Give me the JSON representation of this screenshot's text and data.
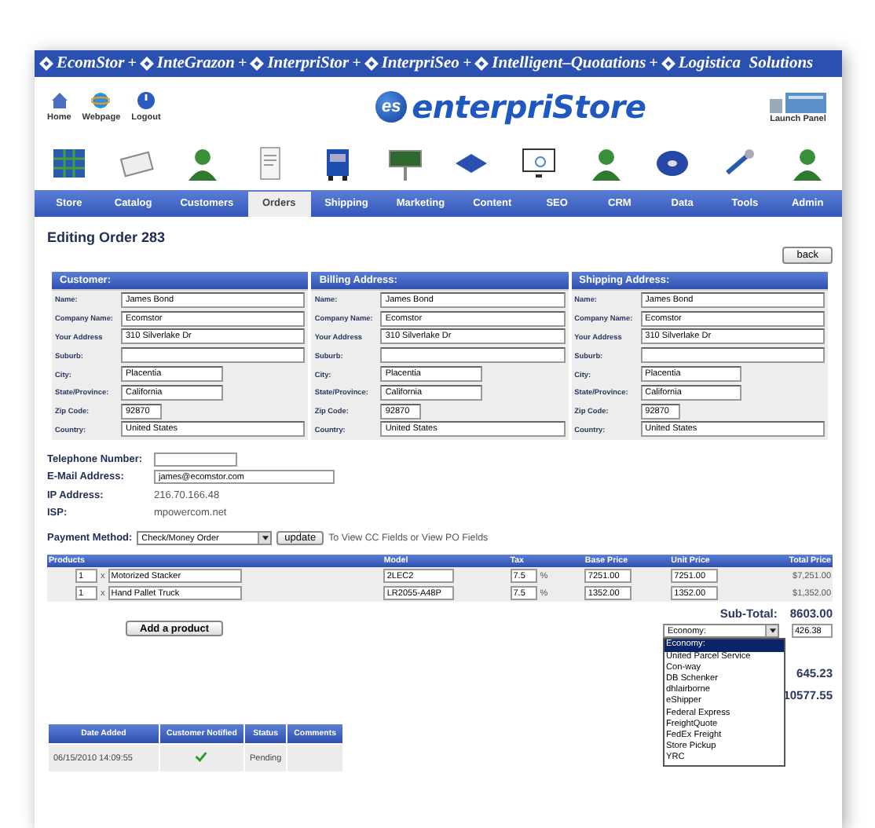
{
  "banner": {
    "brands": [
      {
        "name": "EcomStor"
      },
      {
        "name": "InteGrazon"
      },
      {
        "name": "InterpriStor"
      },
      {
        "name": "InterpriSeo"
      },
      {
        "name": "Intelligent–Quotations"
      },
      {
        "name": "Logistica  Solutions"
      }
    ],
    "separators": [
      "+",
      "+",
      "+",
      "+",
      "+"
    ]
  },
  "header": {
    "links": [
      {
        "label": "Home"
      },
      {
        "label": "Webpage"
      },
      {
        "label": "Logout"
      }
    ],
    "logo_mark": "es",
    "logo_text": "enterpriStore",
    "launch": "Launch Panel"
  },
  "nav": [
    {
      "label": "Store",
      "selected": false
    },
    {
      "label": "Catalog",
      "selected": false
    },
    {
      "label": "Customers",
      "selected": false
    },
    {
      "label": "Orders",
      "selected": true
    },
    {
      "label": "Shipping",
      "selected": false
    },
    {
      "label": "Marketing",
      "selected": false
    },
    {
      "label": "Content",
      "selected": false
    },
    {
      "label": "SEO",
      "selected": false
    },
    {
      "label": "CRM",
      "selected": false
    },
    {
      "label": "Data",
      "selected": false
    },
    {
      "label": "Tools",
      "selected": false
    },
    {
      "label": "Admin",
      "selected": false
    }
  ],
  "title": "Editing Order 283",
  "back_button": "back",
  "address_panels": [
    {
      "title": "Customer:",
      "fields": [
        {
          "label": "Name:",
          "value": "James Bond"
        },
        {
          "label": "Company Name:",
          "value": "Ecomstor"
        },
        {
          "label": "Your Address",
          "value": "310 Silverlake Dr"
        },
        {
          "label": "Suburb:"
        },
        {
          "label": "City:",
          "value": "Placentia"
        },
        {
          "label": "State/Province:",
          "value": "California"
        },
        {
          "label": "Zip Code:",
          "value": "92870"
        },
        {
          "label": "Country:",
          "value": "United States"
        }
      ]
    },
    {
      "title": "Billing Address:",
      "fields": [
        {
          "label": "Name:",
          "value": "James Bond"
        },
        {
          "label": "Company Name:",
          "value": "Ecomstor"
        },
        {
          "label": "Your Address",
          "value": "310 Silverlake Dr"
        },
        {
          "label": "Suburb:"
        },
        {
          "label": "City:",
          "value": "Placentia"
        },
        {
          "label": "State/Province:",
          "value": "California"
        },
        {
          "label": "Zip Code:",
          "value": "92870"
        },
        {
          "label": "Country:",
          "value": "United States"
        }
      ]
    },
    {
      "title": "Shipping Address:",
      "fields": [
        {
          "label": "Name:",
          "value": "James Bond"
        },
        {
          "label": "Company Name:",
          "value": "Ecomstor"
        },
        {
          "label": "Your Address",
          "value": "310 Silverlake Dr"
        },
        {
          "label": "Suburb:"
        },
        {
          "label": "City:",
          "value": "Placentia"
        },
        {
          "label": "State/Province:",
          "value": "California"
        },
        {
          "label": "Zip Code:",
          "value": "92870"
        },
        {
          "label": "Country:",
          "value": "United States"
        }
      ]
    }
  ],
  "contact": [
    {
      "label": "Telephone Number:",
      "kind": "short-input"
    },
    {
      "label": "E-Mail Address:",
      "value": "james@ecomstor.com",
      "kind": "input"
    },
    {
      "label": "IP Address:",
      "value": "216.70.166.48",
      "kind": "text"
    },
    {
      "label": "ISP:",
      "value": "mpowercom.net",
      "kind": "text"
    }
  ],
  "payment": {
    "label": "Payment Method:",
    "value": "Check/Money Order",
    "button": "update",
    "note": "To View CC Fields or View PO Fields"
  },
  "products": {
    "columns": [
      "Products",
      "Model",
      "Tax",
      "Base Price",
      "Unit Price",
      "Total Price"
    ],
    "rows": [
      {
        "qty": "1",
        "times": "x",
        "name": "Motorized Stacker",
        "model": "2LEC2",
        "tax": "7.5",
        "percent": "%",
        "base": "7251.00",
        "unit": "7251.00",
        "total": "$7,251.00"
      },
      {
        "qty": "1",
        "times": "x",
        "name": "Hand Pallet Truck",
        "model": "LR2055-A48P",
        "tax": "7.5",
        "percent": "%",
        "base": "1352.00",
        "unit": "1352.00",
        "total": "$1,352.00"
      }
    ]
  },
  "subtotal": {
    "label": "Sub-Total:",
    "value": "8603.00"
  },
  "add_product": "Add a product",
  "shipping": {
    "value": "Economy:",
    "cost": "426.38",
    "options": [
      {
        "label": "Economy:",
        "selected": true
      },
      {
        "label": "United Parcel Service",
        "selected": false
      },
      {
        "label": "Con-way",
        "selected": false
      },
      {
        "label": "DB Schenker",
        "selected": false
      },
      {
        "label": "dhlairborne",
        "selected": false
      },
      {
        "label": "eShipper",
        "selected": false
      },
      {
        "label": "Federal Express",
        "selected": false
      },
      {
        "label": "FreightQuote",
        "selected": false
      },
      {
        "label": "FedEx Freight",
        "selected": false
      },
      {
        "label": "Store Pickup",
        "selected": false
      },
      {
        "label": "YRC",
        "selected": false
      }
    ]
  },
  "totals": [
    "645.23",
    "10577.55"
  ],
  "history": {
    "columns": [
      "Date Added",
      "Customer Notified",
      "Status",
      "Comments"
    ],
    "rows": [
      {
        "date": "06/15/2010 14:09:55",
        "notified": true,
        "status": "Pending"
      }
    ]
  }
}
